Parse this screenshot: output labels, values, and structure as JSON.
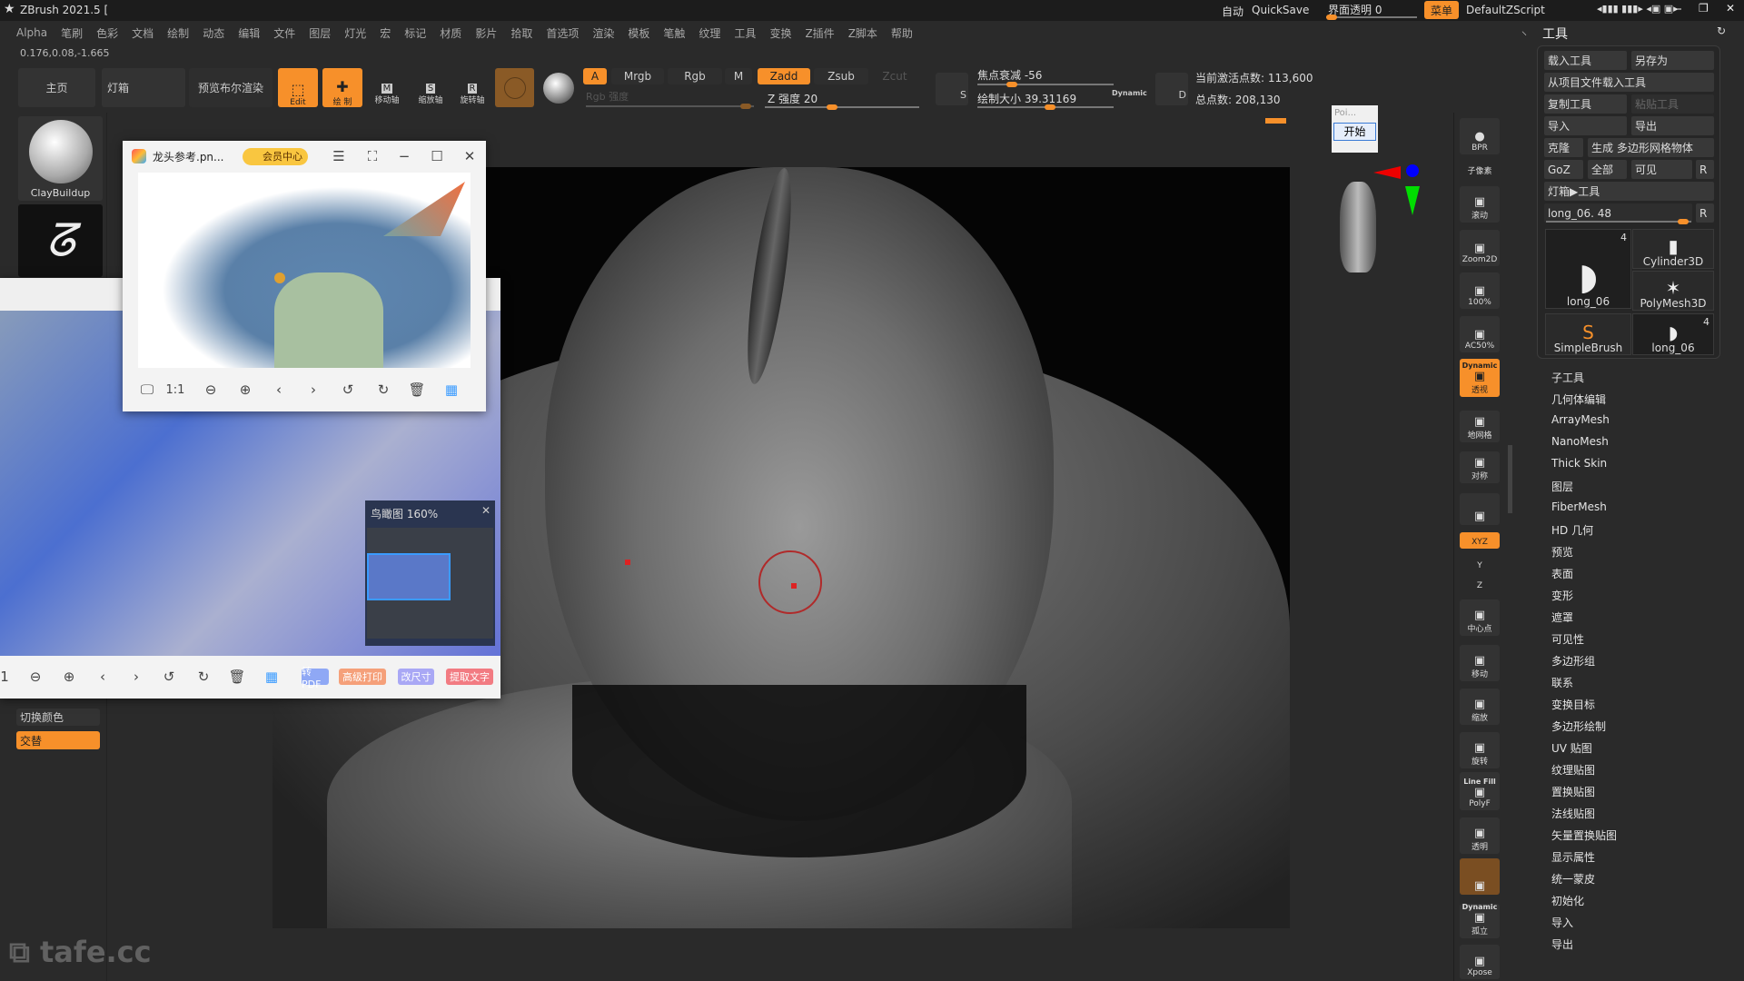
{
  "app": {
    "title": "ZBrush 2021.5 [",
    "coords": "0.176,0.08,-1.665"
  },
  "topright": {
    "auto": "自动",
    "quicksave": "QuickSave",
    "transparency": "界面透明 0",
    "transparency_value": 0,
    "menu": "菜单",
    "script": "DefaultZScript"
  },
  "menu": [
    "Alpha",
    "笔刷",
    "色彩",
    "文档",
    "绘制",
    "动态",
    "编辑",
    "文件",
    "图层",
    "灯光",
    "宏",
    "标记",
    "材质",
    "影片",
    "拾取",
    "首选项",
    "渲染",
    "模板",
    "笔触",
    "纹理",
    "工具",
    "变换",
    "Z插件",
    "Z脚本",
    "帮助"
  ],
  "toolbar": {
    "home": "主页",
    "lightbox": "灯箱",
    "preview_bool": "预览布尔渲染",
    "edit": "Edit",
    "draw": "绘 制",
    "move": "移动轴",
    "scale": "缩放轴",
    "rotate": "旋转轴",
    "a": "A",
    "mrgb": "Mrgb",
    "rgb": "Rgb",
    "m": "M",
    "zadd": "Zadd",
    "zsub": "Zsub",
    "zcut": "Zcut",
    "rgb_intensity": "Rgb 强度",
    "z_intensity": "Z 强度 20",
    "z_intensity_value": 20,
    "focal_shift": "焦点衰减 -56",
    "focal_shift_value": -56,
    "draw_size": "绘制大小 39.31169",
    "draw_size_value": 39.31169,
    "dynamic": "Dynamic",
    "active_points": "当前激活点数: 113,600",
    "total_points": "总点数: 208,130",
    "s": "S",
    "d": "D"
  },
  "left": {
    "brush": "ClayBuildup",
    "switch_color": "切换颜色",
    "alternate": "交替",
    "watermark": "tafe.cc"
  },
  "viewer1": {
    "title": "龙头参考.pn...",
    "vip": "会员中心",
    "tools": [
      "monitor-icon",
      "1:1",
      "zoom-out-icon",
      "zoom-in-icon",
      "prev-icon",
      "next-icon",
      "rotate-left-icon",
      "rotate-right-icon",
      "delete-icon",
      "grid-icon"
    ],
    "one_to_one": "1:1"
  },
  "viewer2": {
    "birdseye": "鸟瞰图 160%",
    "one": "1",
    "pills": [
      "转PDF",
      "高级打印",
      "改尺寸",
      "提取文字"
    ],
    "pill_colors": [
      "#8fa8f5",
      "#f5a07a",
      "#a9a8f5",
      "#f27b82"
    ]
  },
  "popup": {
    "label": "Poi...",
    "start": "开始"
  },
  "tool_panel": {
    "title": "工具",
    "load": "载入工具",
    "save_as": "另存为",
    "load_project": "从项目文件载入工具",
    "copy": "复制工具",
    "paste": "粘贴工具",
    "import": "导入",
    "export": "导出",
    "clone": "克隆",
    "make_polymesh": "生成 多边形网格物体",
    "goz": "GoZ",
    "all": "全部",
    "visible": "可见",
    "r": "R",
    "lightbox_tool": "灯箱▶工具",
    "current_tool": "long_06. 48",
    "current_tool_value": 48,
    "thumbs": [
      {
        "label": "long_06",
        "count": "4"
      },
      {
        "label": "Cylinder3D"
      },
      {
        "label": "PolyMesh3D"
      },
      {
        "label": "SimpleBrush"
      },
      {
        "label": "long_06",
        "count": "4"
      }
    ],
    "sections": [
      "子工具",
      "几何体编辑",
      "ArrayMesh",
      "NanoMesh",
      "Thick Skin",
      "图层",
      "FiberMesh",
      "HD 几何",
      "预览",
      "表面",
      "变形",
      "遮罩",
      "可见性",
      "多边形组",
      "联系",
      "变换目标",
      "多边形绘制",
      "UV 贴图",
      "纹理贴图",
      "置换贴图",
      "法线贴图",
      "矢量置换贴图",
      "显示属性",
      "统一蒙皮",
      "初始化",
      "导入",
      "导出"
    ]
  },
  "shelf": [
    {
      "label": "BPR",
      "top": ""
    },
    {
      "label": "子像素"
    },
    {
      "label": "滚动"
    },
    {
      "label": "Zoom2D"
    },
    {
      "label": "100%"
    },
    {
      "label": "AC50%"
    },
    {
      "label": "透视",
      "top": "Dynamic",
      "active": true
    },
    {
      "label": "地网格"
    },
    {
      "label": "对称"
    },
    {
      "label": "",
      "icon": "lock-camera-icon"
    },
    {
      "label": "XYZ",
      "active": true
    },
    {
      "label": "Y"
    },
    {
      "label": "Z"
    },
    {
      "label": "中心点"
    },
    {
      "label": "移动"
    },
    {
      "label": "缩放"
    },
    {
      "label": "旋转"
    },
    {
      "label": "PolyF",
      "top": "Line Fill"
    },
    {
      "label": "透明"
    },
    {
      "label": "",
      "icon": "ghost-icon",
      "dim": true
    },
    {
      "label": "孤立",
      "top": "Dynamic"
    },
    {
      "label": "Xpose"
    }
  ],
  "colors": {
    "accent": "#f7902a",
    "bg": "#2a2a2a"
  }
}
